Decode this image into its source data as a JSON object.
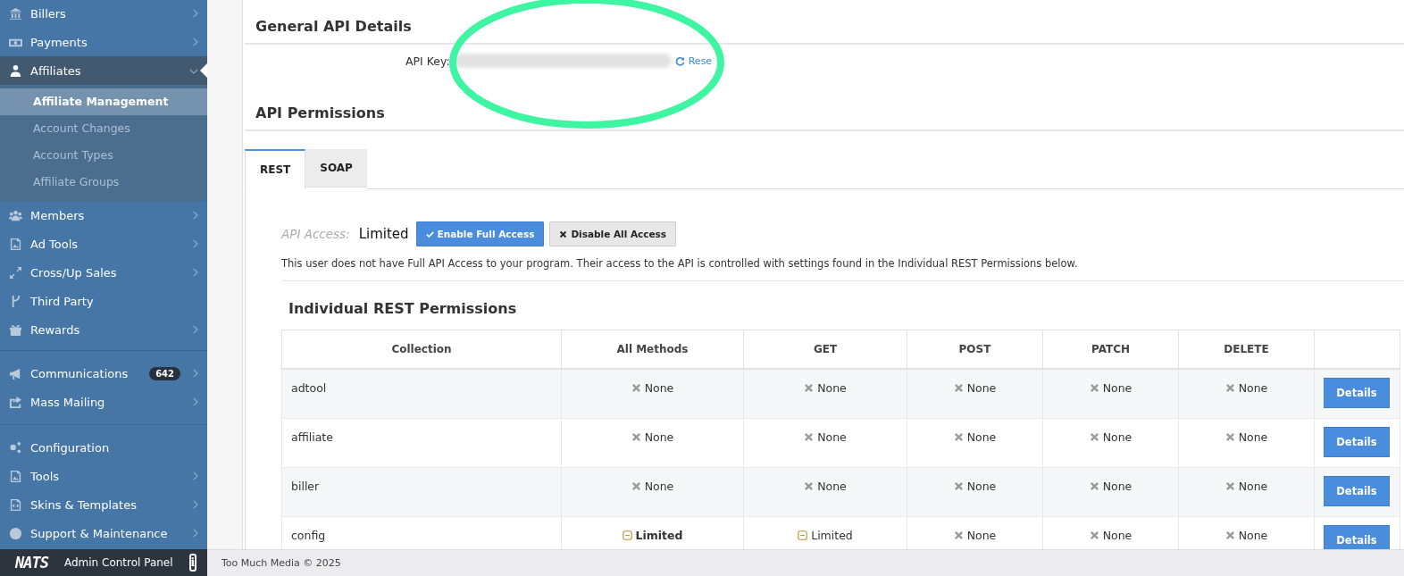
{
  "sidebar": {
    "groups": [
      {
        "items": [
          {
            "label": "Billers",
            "arrow": true,
            "expanded": false,
            "selected": false
          },
          {
            "label": "Payments",
            "arrow": true,
            "expanded": false,
            "selected": false
          },
          {
            "label": "Affiliates",
            "arrow": true,
            "expanded": true,
            "selected": true,
            "children": [
              {
                "label": "Affiliate Management",
                "selected": true
              },
              {
                "label": "Account Changes",
                "selected": false
              },
              {
                "label": "Account Types",
                "selected": false
              },
              {
                "label": "Affiliate Groups",
                "selected": false
              }
            ]
          },
          {
            "label": "Members",
            "arrow": true,
            "expanded": false,
            "selected": false
          },
          {
            "label": "Ad Tools",
            "arrow": true,
            "expanded": false,
            "selected": false
          },
          {
            "label": "Cross/Up Sales",
            "arrow": true,
            "expanded": false,
            "selected": false
          },
          {
            "label": "Third Party",
            "arrow": false,
            "selected": false
          },
          {
            "label": "Rewards",
            "arrow": true,
            "expanded": false,
            "selected": false
          }
        ]
      },
      {
        "items": [
          {
            "label": "Communications",
            "badge": "642",
            "arrow": true,
            "expanded": false,
            "selected": false
          },
          {
            "label": "Mass Mailing",
            "arrow": true,
            "expanded": false,
            "selected": false
          }
        ]
      },
      {
        "items": [
          {
            "label": "Configuration",
            "arrow": false,
            "selected": false
          },
          {
            "label": "Tools",
            "arrow": true,
            "expanded": false,
            "selected": false
          },
          {
            "label": "Skins & Templates",
            "arrow": true,
            "expanded": false,
            "selected": false
          },
          {
            "label": "Support & Maintenance",
            "arrow": true,
            "expanded": false,
            "selected": false
          }
        ]
      }
    ],
    "footer": {
      "logo": "NATS",
      "title": "Admin Control Panel",
      "info": "i"
    }
  },
  "general": {
    "title": "General API Details",
    "api_key_label": "API Key:",
    "reset_link": "Rese"
  },
  "permissions": {
    "title": "API Permissions",
    "tabs": [
      {
        "label": "REST",
        "selected": true
      },
      {
        "label": "SOAP",
        "selected": false
      }
    ],
    "access_label": "API Access:",
    "access_value": "Limited",
    "buttons": [
      {
        "label": "Enable Full Access",
        "kind": "primary"
      },
      {
        "label": "Disable All Access",
        "kind": "default"
      }
    ],
    "notice": "This user does not have Full API Access to your program. Their access to the API is controlled with settings found in the Individual REST Permissions below.",
    "table": {
      "title": "Individual REST Permissions",
      "columns": [
        "Collection",
        "All Methods",
        "GET",
        "POST",
        "PATCH",
        "DELETE"
      ],
      "rows": [
        {
          "cells": [
            {
              "kind": "text",
              "text": "adtool"
            },
            {
              "kind": "none",
              "text": "None",
              "bold": false
            },
            {
              "kind": "none",
              "text": "None",
              "bold": false
            },
            {
              "kind": "none",
              "text": "None",
              "bold": false
            },
            {
              "kind": "none",
              "text": "None",
              "bold": false
            },
            {
              "kind": "none",
              "text": "None",
              "bold": false
            },
            {
              "kind": "button",
              "text": "Details"
            }
          ]
        },
        {
          "cells": [
            {
              "kind": "text",
              "text": "affiliate"
            },
            {
              "kind": "none",
              "text": "None",
              "bold": false
            },
            {
              "kind": "none",
              "text": "None",
              "bold": false
            },
            {
              "kind": "none",
              "text": "None",
              "bold": false
            },
            {
              "kind": "none",
              "text": "None",
              "bold": false
            },
            {
              "kind": "none",
              "text": "None",
              "bold": false
            },
            {
              "kind": "button",
              "text": "Details"
            }
          ]
        },
        {
          "cells": [
            {
              "kind": "text",
              "text": "biller"
            },
            {
              "kind": "none",
              "text": "None",
              "bold": false
            },
            {
              "kind": "none",
              "text": "None",
              "bold": false
            },
            {
              "kind": "none",
              "text": "None",
              "bold": false
            },
            {
              "kind": "none",
              "text": "None",
              "bold": false
            },
            {
              "kind": "none",
              "text": "None",
              "bold": false
            },
            {
              "kind": "button",
              "text": "Details"
            }
          ]
        },
        {
          "cells": [
            {
              "kind": "text",
              "text": "config"
            },
            {
              "kind": "limited",
              "text": "Limited",
              "bold": true
            },
            {
              "kind": "limited",
              "text": "Limited",
              "bold": false
            },
            {
              "kind": "none",
              "text": "None",
              "bold": false
            },
            {
              "kind": "none",
              "text": "None",
              "bold": false
            },
            {
              "kind": "none",
              "text": "None",
              "bold": false
            },
            {
              "kind": "button",
              "text": "Details"
            }
          ]
        }
      ]
    }
  },
  "footer": {
    "copyright": "Too Much Media © 2025"
  }
}
